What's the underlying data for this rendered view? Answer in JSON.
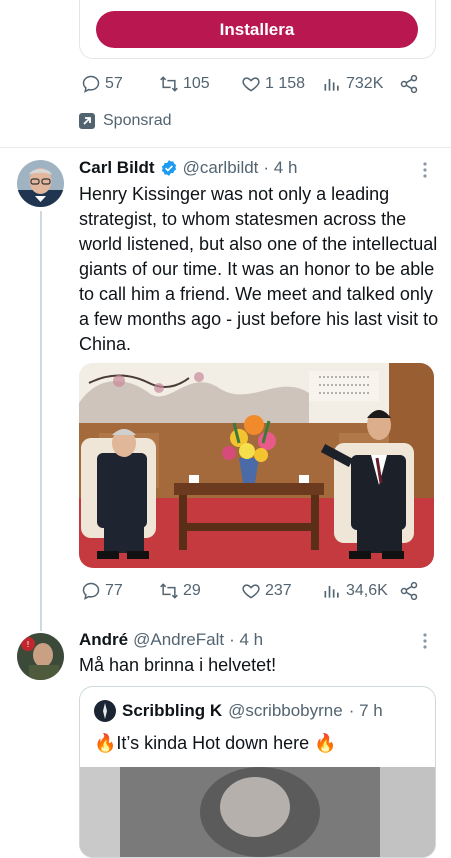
{
  "ad": {
    "install_label": "Installera",
    "stats": {
      "replies": "57",
      "retweets": "105",
      "likes": "1 158",
      "views": "732K"
    },
    "sponsored_label": "Sponsrad"
  },
  "tweet1": {
    "name": "Carl Bildt",
    "handle": "@carlbildt",
    "time": "· 4 h",
    "text": "Henry Kissinger was not only a leading strategist, to whom statesmen across the world listened, but also one of the intellectual giants of our time. It was an honor to be able to call him a friend. We meet and talked only a few months ago - just before his last visit to China.",
    "stats": {
      "replies": "77",
      "retweets": "29",
      "likes": "237",
      "views": "34,6K"
    }
  },
  "tweet2": {
    "name": "André",
    "handle": "@AndreFalt",
    "time": "· 4 h",
    "text": "Må han brinna i helvetet!",
    "quote": {
      "name": "Scribbling K",
      "handle": "@scribbobyrne",
      "time": "· 7 h",
      "text": "🔥It’s kinda Hot down here 🔥"
    }
  },
  "colors": {
    "install_bg": "#b8174f",
    "verified": "#1d9bf0",
    "secondary_text": "#536471"
  }
}
